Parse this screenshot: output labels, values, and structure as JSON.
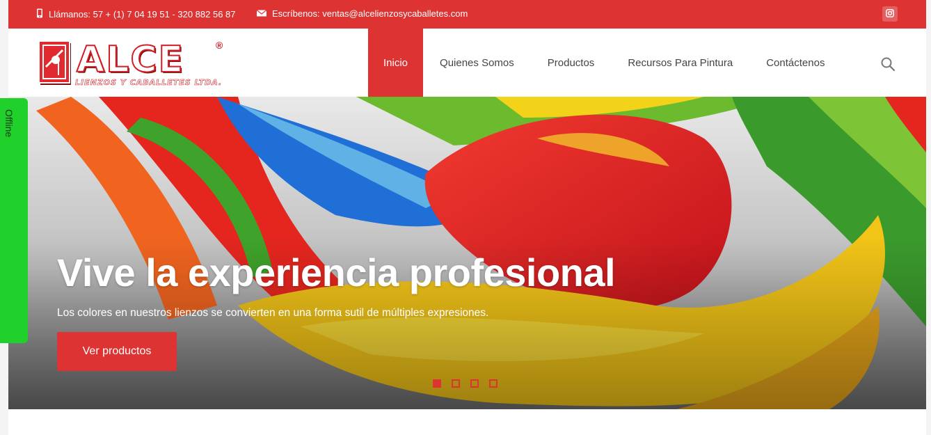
{
  "topbar": {
    "phone": "Llámanos: 57 + (1) 7 04 19 51 - 320 882 56 87",
    "email": "Escríbenos: ventas@alcelienzosycaballetes.com",
    "phone_icon": "mobile-phone-icon",
    "email_icon": "envelope-icon",
    "social_icon": "instagram-icon"
  },
  "logo": {
    "text": "ALCE",
    "registered": "®",
    "subtitle": "LIENZOS Y CABALLETES LTDA."
  },
  "nav": {
    "items": [
      {
        "label": "Inicio",
        "active": true
      },
      {
        "label": "Quienes Somos",
        "active": false
      },
      {
        "label": "Productos",
        "active": false
      },
      {
        "label": "Recursos Para Pintura",
        "active": false
      },
      {
        "label": "Contáctenos",
        "active": false
      }
    ],
    "search_icon": "search-icon"
  },
  "hero": {
    "title": "Vive la experiencia profesional",
    "subtitle": "Los colores en nuestros lienzos se convierten en una forma sutil de múltiples expresiones.",
    "cta": "Ver productos",
    "slides": 4,
    "active_slide": 1
  },
  "offline_tab": {
    "label": "Offline"
  },
  "colors": {
    "brand_red": "#dd3333",
    "offline_green": "#1fd12a"
  }
}
